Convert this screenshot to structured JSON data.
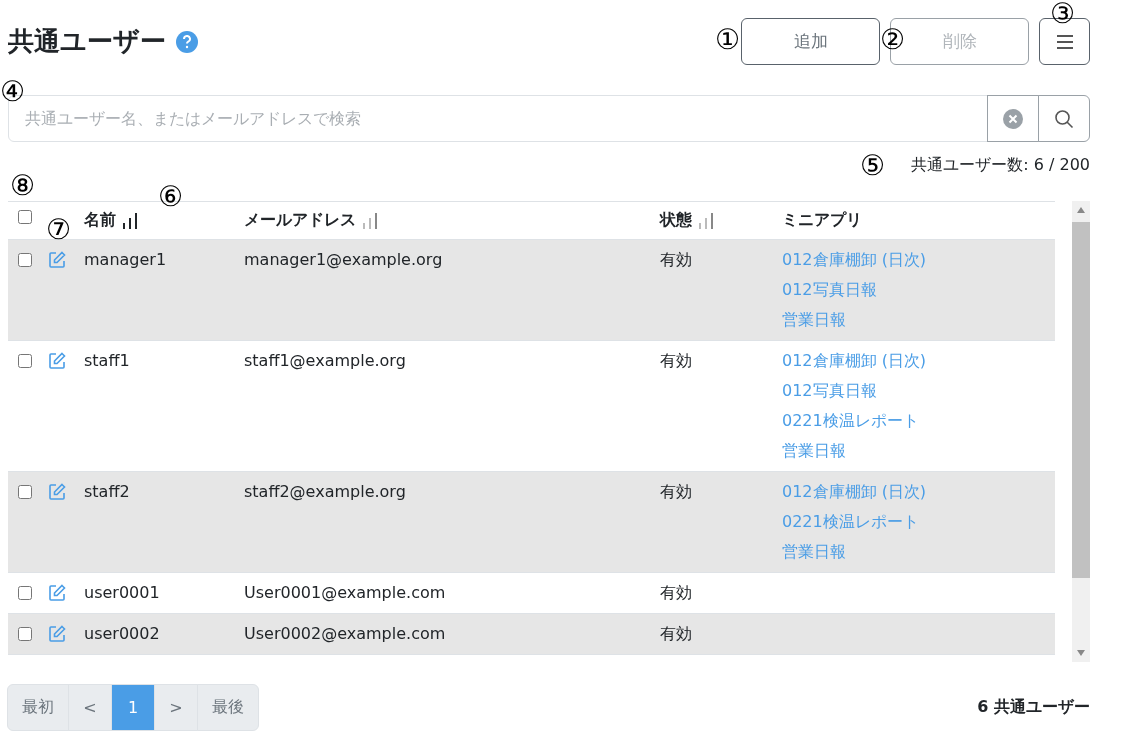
{
  "title": "共通ユーザー",
  "buttons": [
    {
      "label": "追加",
      "disabled": false
    },
    {
      "label": "削除",
      "disabled": true
    }
  ],
  "search": {
    "placeholder": "共通ユーザー名、またはメールアドレスで検索"
  },
  "user_count": "共通ユーザー数: 6 / 200",
  "table": {
    "select_all": {
      "checked": false
    },
    "columns": [
      {
        "label": "名前",
        "sorted": true
      },
      {
        "label": "メールアドレス",
        "sorted": false
      },
      {
        "label": "状態",
        "sorted": false
      },
      {
        "label": "ミニアプリ"
      }
    ],
    "rows": [
      {
        "checked": false,
        "name": "manager1",
        "email": "manager1@example.org",
        "status": "有効",
        "apps": [
          "012倉庫棚卸 (日次)",
          "012写真日報",
          "営業日報"
        ]
      },
      {
        "checked": false,
        "name": "staff1",
        "email": "staff1@example.org",
        "status": "有効",
        "apps": [
          "012倉庫棚卸 (日次)",
          "012写真日報",
          "0221検温レポート",
          "営業日報"
        ]
      },
      {
        "checked": false,
        "name": "staff2",
        "email": "staff2@example.org",
        "status": "有効",
        "apps": [
          "012倉庫棚卸 (日次)",
          "0221検温レポート",
          "営業日報"
        ]
      },
      {
        "checked": false,
        "name": "user0001",
        "email": "User0001@example.com",
        "status": "有効",
        "apps": []
      },
      {
        "checked": false,
        "name": "user0002",
        "email": "User0002@example.com",
        "status": "有効",
        "apps": []
      }
    ]
  },
  "pagination": [
    {
      "label": "最初",
      "selected": false
    },
    {
      "label": "<",
      "selected": false
    },
    {
      "label": "1",
      "selected": true
    },
    {
      "label": ">",
      "selected": false
    },
    {
      "label": "最後",
      "selected": false
    }
  ],
  "footer_total": "6 共通ユーザー",
  "callouts": [
    "①",
    "②",
    "③",
    "④",
    "⑤",
    "⑥",
    "⑦",
    "⑧"
  ]
}
